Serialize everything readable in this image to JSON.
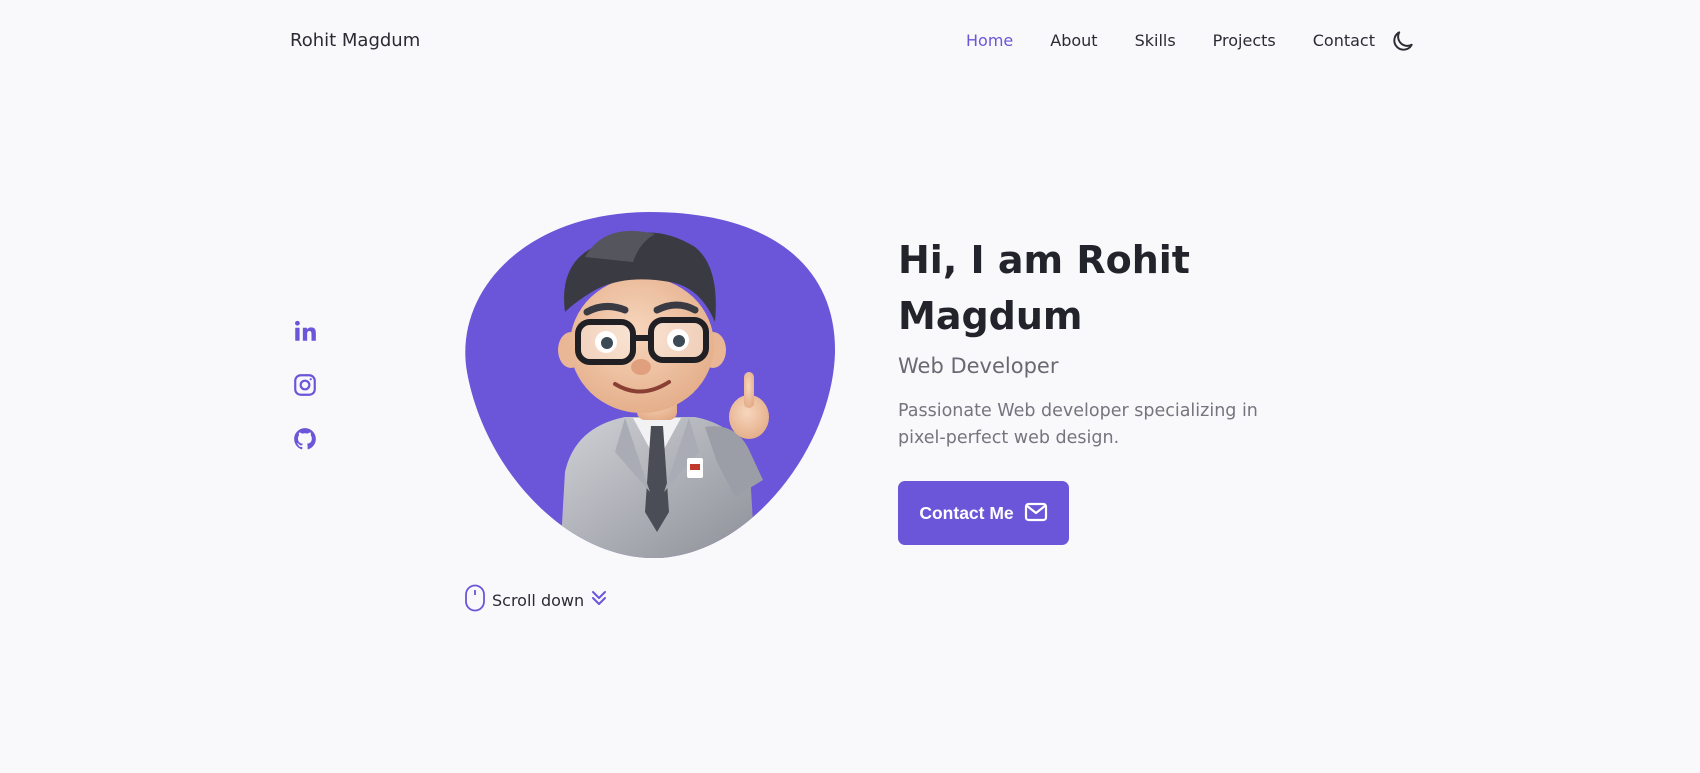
{
  "header": {
    "brand": "Rohit Magdum",
    "nav": [
      {
        "label": "Home",
        "active": true
      },
      {
        "label": "About",
        "active": false
      },
      {
        "label": "Skills",
        "active": false
      },
      {
        "label": "Projects",
        "active": false
      },
      {
        "label": "Contact",
        "active": false
      }
    ],
    "theme_icon": "moon-icon"
  },
  "social": [
    {
      "icon": "linkedin-icon"
    },
    {
      "icon": "instagram-icon"
    },
    {
      "icon": "github-icon"
    }
  ],
  "hero": {
    "title": "Hi, I am Rohit Magdum",
    "subtitle": "Web Developer",
    "description": "Passionate Web developer specializing in pixel-perfect web design.",
    "cta_label": "Contact Me",
    "cta_icon": "envelope-icon",
    "avatar": "cartoon-developer-avatar"
  },
  "scroll": {
    "label": "Scroll down",
    "icon_left": "mouse-icon",
    "icon_right": "double-chevron-down-icon"
  },
  "colors": {
    "accent": "#6b55d9",
    "background": "#f9f9fb",
    "text": "#2b2b33",
    "muted": "#76747e"
  }
}
